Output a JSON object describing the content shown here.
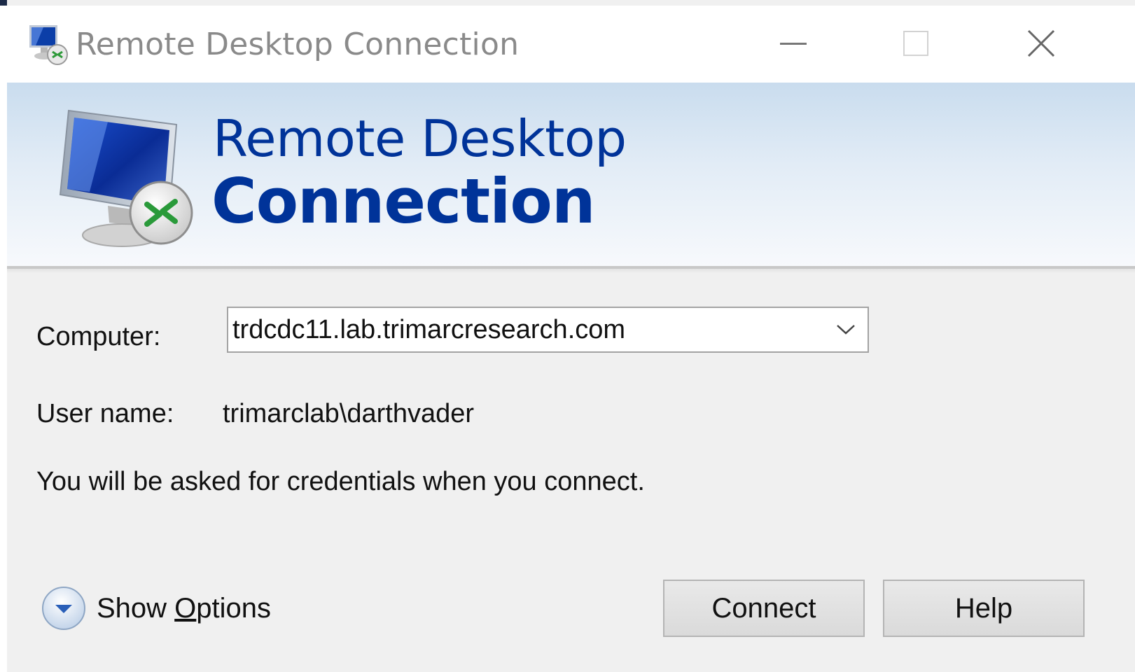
{
  "window": {
    "title": "Remote Desktop Connection",
    "controls": {
      "minimize": "minimize",
      "maximize": "maximize",
      "close": "close"
    }
  },
  "banner": {
    "line1": "Remote Desktop",
    "line2": "Connection",
    "brand_color": "#003399"
  },
  "form": {
    "computer_label": "Computer:",
    "computer_value": "trdcdc11.lab.trimarcresearch.com",
    "username_label": "User name:",
    "username_value": "trimarclab\\darthvader",
    "credentials_note": "You will be asked for credentials when you connect."
  },
  "footer": {
    "show_options_prefix": "Show ",
    "show_options_accel": "O",
    "show_options_suffix": "ptions",
    "connect_label": "Connect",
    "help_label": "Help"
  },
  "icons": [
    "remote-desktop-app-icon",
    "minimize-icon",
    "maximize-icon",
    "close-icon",
    "remote-desktop-logo-icon",
    "chevron-down-icon",
    "expand-options-icon"
  ]
}
